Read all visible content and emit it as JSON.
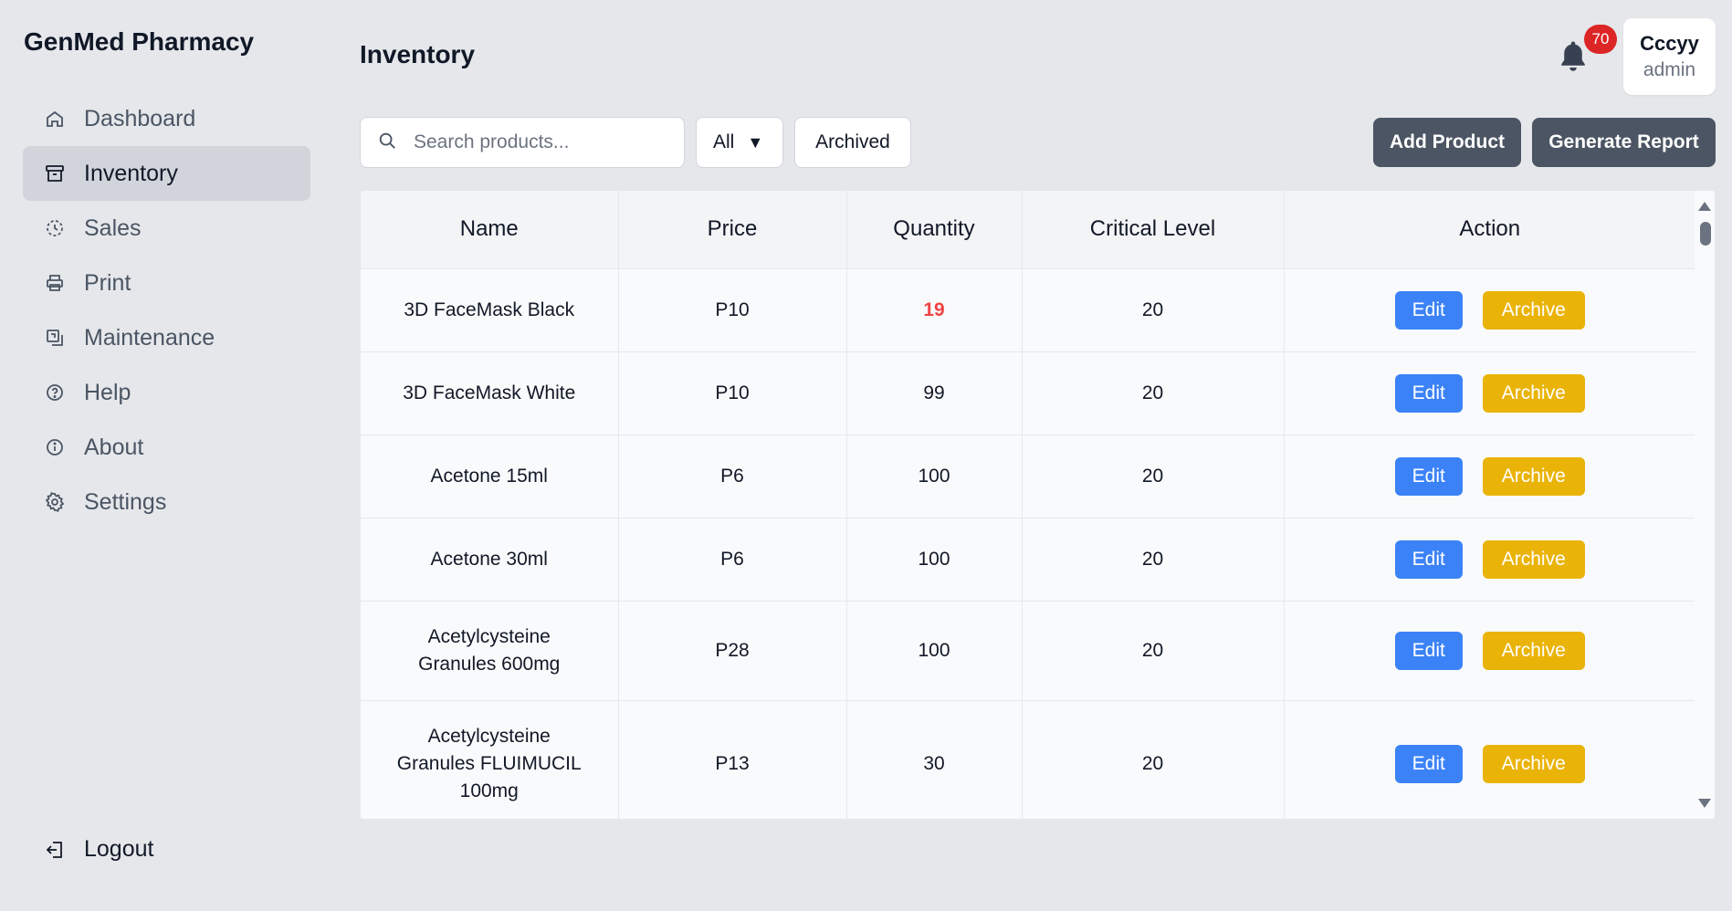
{
  "app": {
    "name": "GenMed Pharmacy"
  },
  "sidebar": {
    "items": [
      {
        "label": "Dashboard",
        "icon": "home-icon"
      },
      {
        "label": "Inventory",
        "icon": "archive-box-icon",
        "active": true
      },
      {
        "label": "Sales",
        "icon": "clock-icon"
      },
      {
        "label": "Print",
        "icon": "printer-icon"
      },
      {
        "label": "Maintenance",
        "icon": "maintenance-icon"
      },
      {
        "label": "Help",
        "icon": "help-circle-icon"
      },
      {
        "label": "About",
        "icon": "info-circle-icon"
      },
      {
        "label": "Settings",
        "icon": "gear-icon"
      }
    ],
    "logout_label": "Logout"
  },
  "header": {
    "title": "Inventory",
    "notifications_count": "70",
    "user": {
      "name": "Cccyy",
      "role": "admin"
    }
  },
  "toolbar": {
    "search_placeholder": "Search products...",
    "filter_value": "All",
    "archived_label": "Archived",
    "add_label": "Add Product",
    "report_label": "Generate Report"
  },
  "table": {
    "columns": [
      "Name",
      "Price",
      "Quantity",
      "Critical Level",
      "Action"
    ],
    "edit_label": "Edit",
    "archive_label": "Archive",
    "rows": [
      {
        "name": "3D FaceMask Black",
        "price": "P10",
        "quantity": "19",
        "critical": "20",
        "low": true
      },
      {
        "name": "3D FaceMask White",
        "price": "P10",
        "quantity": "99",
        "critical": "20",
        "low": false
      },
      {
        "name": "Acetone 15ml",
        "price": "P6",
        "quantity": "100",
        "critical": "20",
        "low": false
      },
      {
        "name": "Acetone 30ml",
        "price": "P6",
        "quantity": "100",
        "critical": "20",
        "low": false
      },
      {
        "name": "Acetylcysteine Granules 600mg",
        "price": "P28",
        "quantity": "100",
        "critical": "20",
        "low": false
      },
      {
        "name": "Acetylcysteine Granules FLUIMUCIL 100mg",
        "price": "P13",
        "quantity": "30",
        "critical": "20",
        "low": false
      }
    ]
  },
  "colors": {
    "background": "#e5e7eb",
    "edit": "#3b82f6",
    "archive": "#eab308",
    "dark_button": "#4b5563",
    "badge": "#dc2626",
    "low_stock": "#ef4444"
  }
}
